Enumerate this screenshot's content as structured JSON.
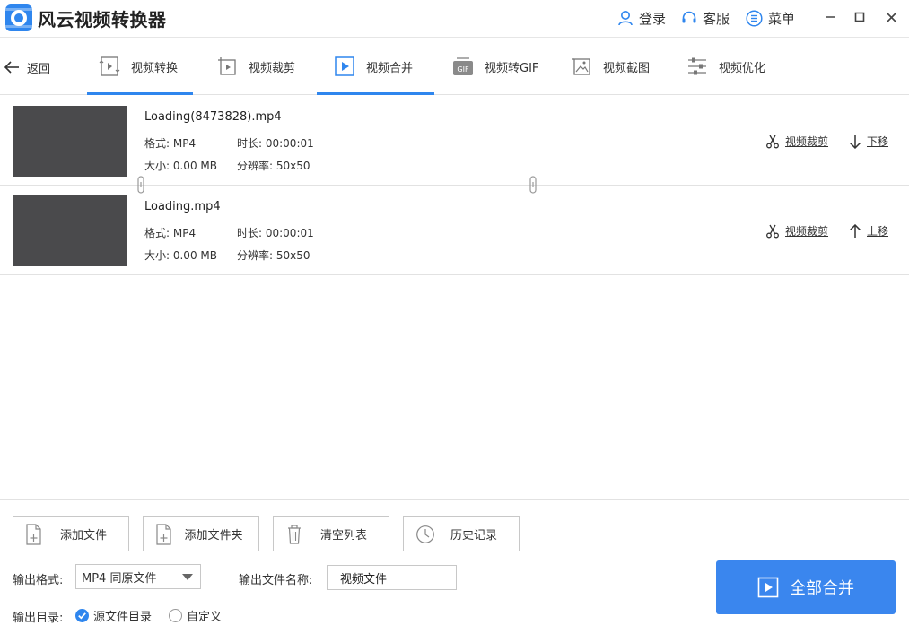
{
  "app": {
    "title": "风云视频转换器"
  },
  "header": {
    "login": "登录",
    "support": "客服",
    "menu": "菜单"
  },
  "nav": {
    "back": "返回",
    "tabs": [
      {
        "label": "视频转换",
        "icon": "video-convert-icon",
        "active": false
      },
      {
        "label": "视频裁剪",
        "icon": "video-crop-icon",
        "active": false
      },
      {
        "label": "视频合并",
        "icon": "video-merge-icon",
        "active": true
      },
      {
        "label": "视频转GIF",
        "icon": "gif-icon",
        "active": false
      },
      {
        "label": "视频截图",
        "icon": "screenshot-icon",
        "active": false
      },
      {
        "label": "视频优化",
        "icon": "optimize-icon",
        "active": false
      }
    ]
  },
  "files": [
    {
      "name": "Loading(8473828).mp4",
      "format": "格式: MP4",
      "duration": "时长: 00:00:01",
      "size": "大小: 0.00 MB",
      "resolution": "分辨率: 50x50",
      "crop_label": "视频裁剪",
      "move_label": "下移"
    },
    {
      "name": "Loading.mp4",
      "format": "格式: MP4",
      "duration": "时长: 00:00:01",
      "size": "大小: 0.00 MB",
      "resolution": "分辨率: 50x50",
      "crop_label": "视频裁剪",
      "move_label": "上移"
    }
  ],
  "actions": {
    "add_file": "添加文件",
    "add_folder": "添加文件夹",
    "clear_list": "清空列表",
    "history": "历史记录"
  },
  "output": {
    "format_label": "输出格式:",
    "format_value": "MP4 同原文件",
    "filename_label": "输出文件名称:",
    "filename_value": "视频文件",
    "dir_label": "输出目录:",
    "dir_option_source": "源文件目录",
    "dir_option_custom": "自定义",
    "dir_selected": "源文件目录"
  },
  "merge_button": "全部合并",
  "colors": {
    "accent": "#2f86ee",
    "thumbnail": "#4a4a4c"
  }
}
